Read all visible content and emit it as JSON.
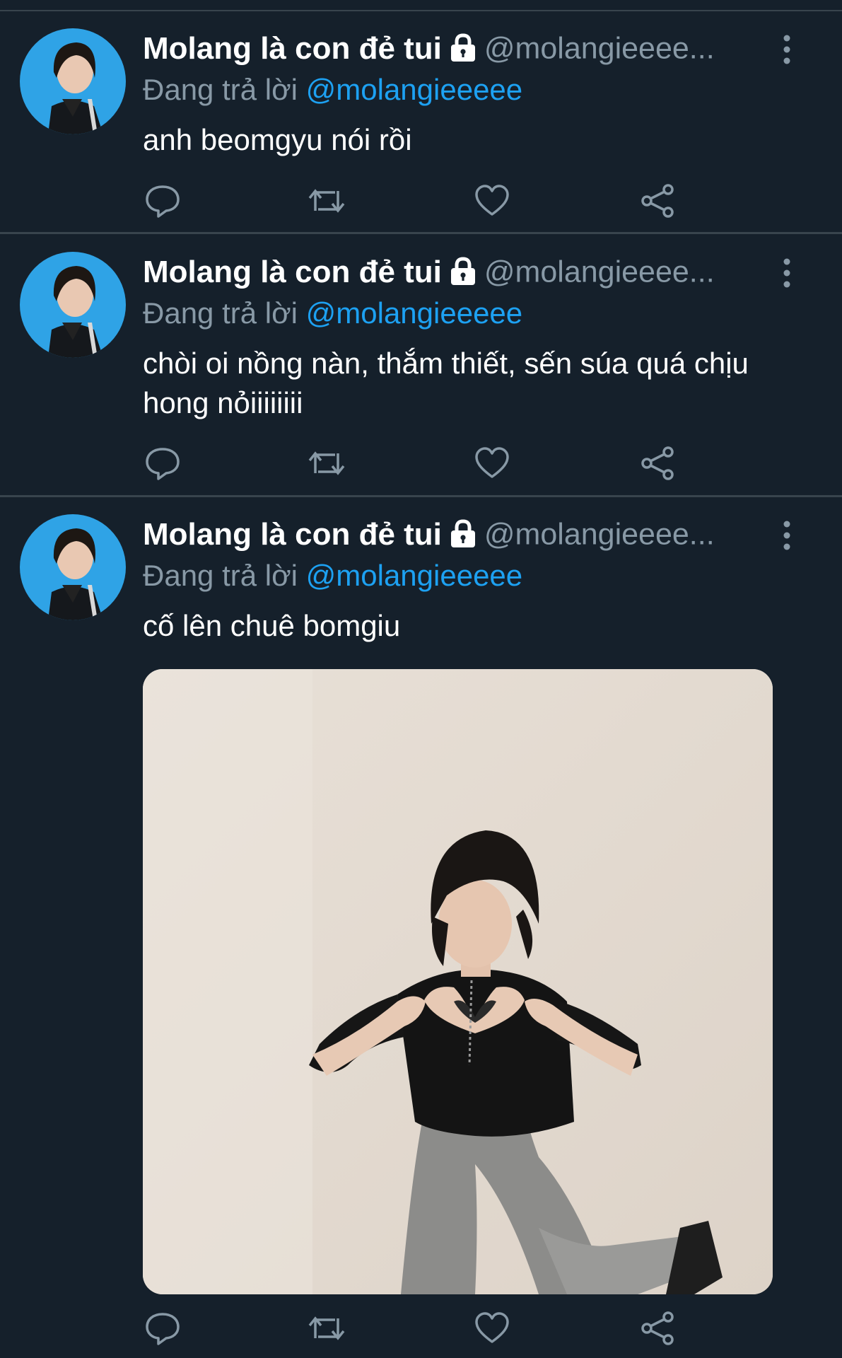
{
  "tweets": [
    {
      "name": "Molang là con đẻ tui",
      "handle": "@molangieeee...",
      "replying_prefix": "Đang trả lời",
      "replying_to": "@molangieeeee",
      "text": "anh beomgyu nói rồi",
      "icons": [
        "reply-icon",
        "retweet-icon",
        "like-icon",
        "share-icon"
      ]
    },
    {
      "name": "Molang là con đẻ tui",
      "handle": "@molangieeee...",
      "replying_prefix": "Đang trả lời",
      "replying_to": "@molangieeeee",
      "text": "chòi oi nồng nàn, thắm thiết, sến súa quá chịu hong nỏiiiiiiii",
      "icons": [
        "reply-icon",
        "retweet-icon",
        "like-icon",
        "share-icon"
      ]
    },
    {
      "name": "Molang là con đẻ tui",
      "handle": "@molangieeee...",
      "replying_prefix": "Đang trả lời",
      "replying_to": "@molangieeeee",
      "text": "cố lên chuê bomgiu",
      "icons": [
        "reply-icon",
        "retweet-icon",
        "like-icon",
        "share-icon"
      ]
    }
  ],
  "colors": {
    "background": "#15202b",
    "divider": "#38444d",
    "secondary_text": "#8899a6",
    "accent": "#1da1f2",
    "avatar_bg": "#2fa3e6"
  }
}
